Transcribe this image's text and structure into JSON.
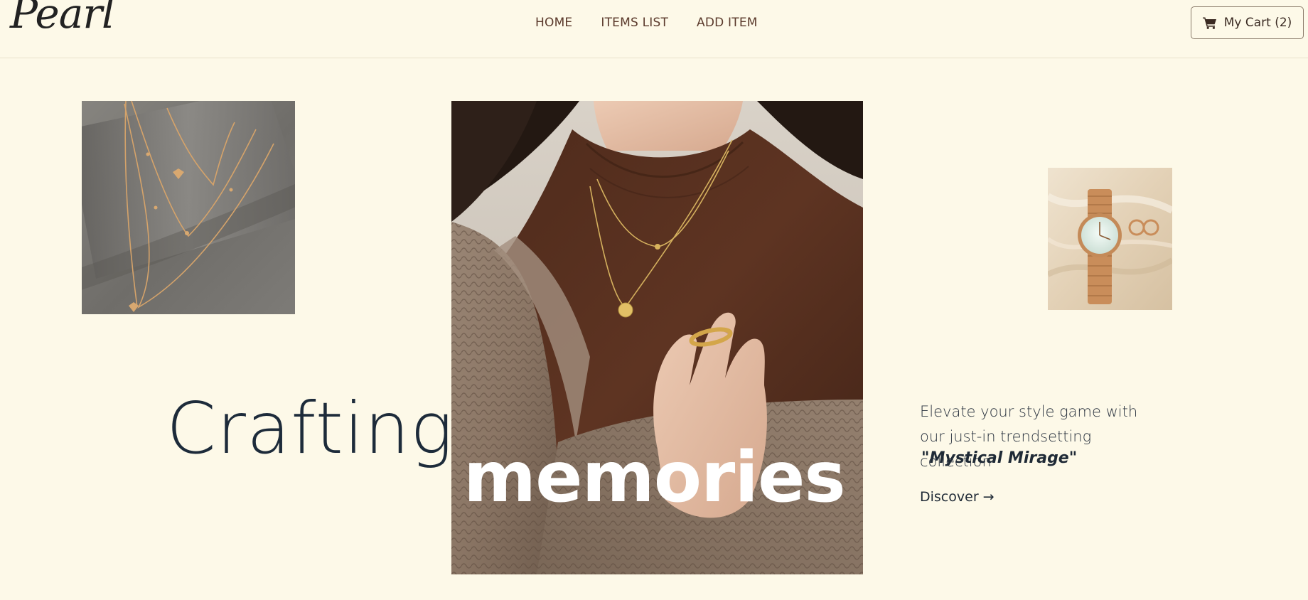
{
  "brand": {
    "logo_text": "Pearl"
  },
  "nav": {
    "links": [
      {
        "label": "HOME"
      },
      {
        "label": "ITEMS LIST"
      },
      {
        "label": "ADD ITEM"
      }
    ],
    "cart": {
      "label": "My Cart (2)",
      "icon": "shopping-cart-icon"
    }
  },
  "hero": {
    "headline_light": "Crafting",
    "headline_bold": "memories",
    "tagline": "Elevate your style game with our just-in trendsetting collection",
    "collection_name": "\"Mystical Mirage\"",
    "cta_label": "Discover →"
  },
  "images": {
    "left": "gold-heart-layered-necklaces-photo",
    "center": "woman-sweater-gold-necklace-ring-photo",
    "right": "rose-gold-watch-earrings-photo"
  },
  "colors": {
    "background": "#fdf9e8",
    "nav_text": "#5b3a2c",
    "headline": "#1d2b3a",
    "accent_gold": "#c89a52"
  }
}
